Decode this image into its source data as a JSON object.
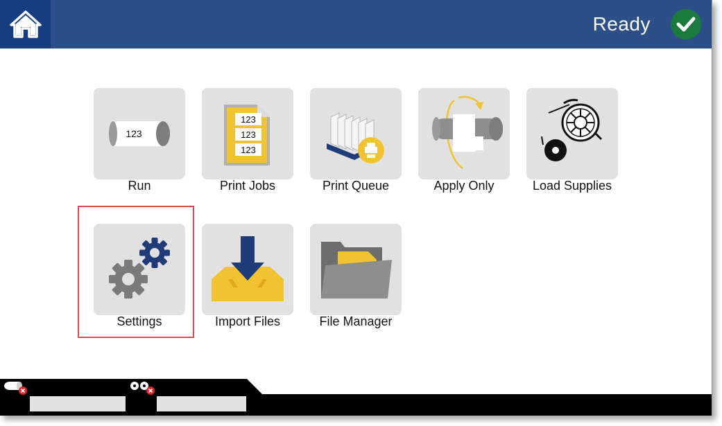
{
  "header": {
    "status": "Ready",
    "colors": {
      "bar": "#2c4f8a",
      "home": "#163d80",
      "status_ok": "#1b7a3d"
    }
  },
  "tiles": [
    {
      "label": "Run",
      "icon": "label-roll-icon",
      "inner_text": "123"
    },
    {
      "label": "Print Jobs",
      "icon": "print-jobs-icon",
      "inner_text": [
        "123",
        "123",
        "123"
      ]
    },
    {
      "label": "Print Queue",
      "icon": "print-queue-icon"
    },
    {
      "label": "Apply Only",
      "icon": "apply-only-icon"
    },
    {
      "label": "Load Supplies",
      "icon": "load-supplies-icon"
    },
    {
      "label": "Settings",
      "icon": "settings-gears-icon",
      "selected": true
    },
    {
      "label": "Import Files",
      "icon": "import-files-icon"
    },
    {
      "label": "File Manager",
      "icon": "file-manager-icon"
    }
  ],
  "footer": {
    "supplies": [
      {
        "icon": "label-supply-error-icon",
        "value": ""
      },
      {
        "icon": "ribbon-supply-error-icon",
        "value": ""
      }
    ]
  }
}
